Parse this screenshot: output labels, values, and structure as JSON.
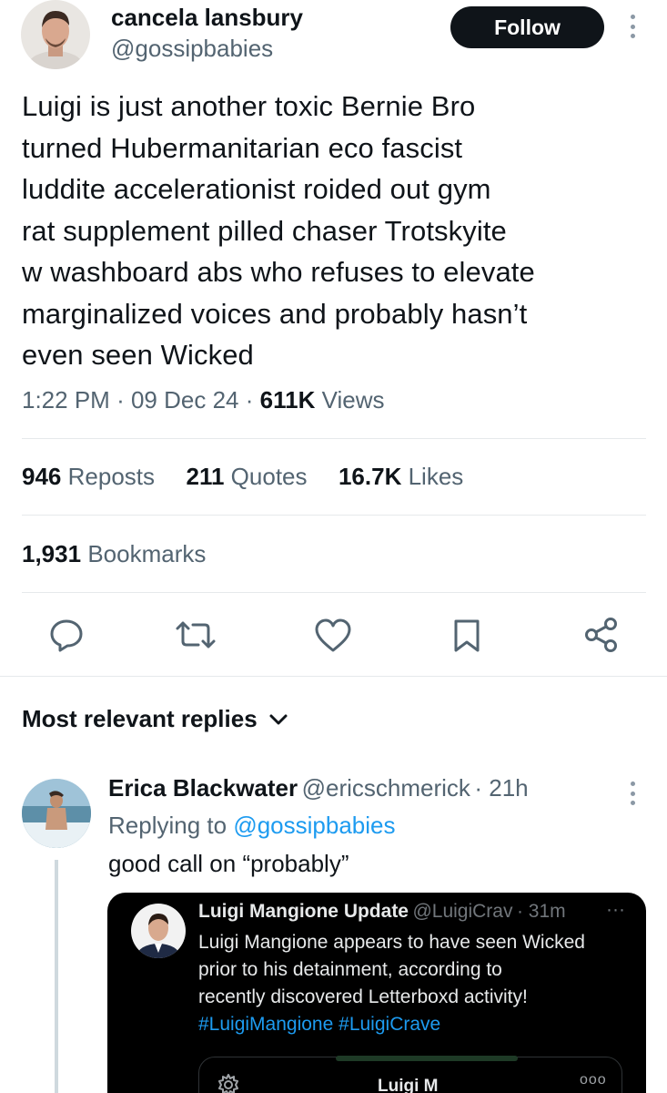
{
  "author": {
    "name": "cancela lansbury",
    "handle": "@gossipbabies",
    "follow_label": "Follow"
  },
  "tweet": {
    "lines": [
      "Luigi is just another toxic Bernie Bro",
      "turned Hubermanitarian eco fascist",
      "luddite accelerationist roided out gym",
      "rat supplement pilled chaser Trotskyite",
      "w washboard abs who refuses to elevate",
      "marginalized voices and probably hasn’t",
      "even seen Wicked"
    ],
    "time": "1:22 PM",
    "date": "09 Dec 24",
    "views_count": "611K",
    "views_label": "Views",
    "sep": "·"
  },
  "stats": {
    "reposts_count": "946",
    "reposts_label": "Reposts",
    "quotes_count": "211",
    "quotes_label": "Quotes",
    "likes_count": "16.7K",
    "likes_label": "Likes",
    "bookmarks_count": "1,931",
    "bookmarks_label": "Bookmarks"
  },
  "actions": [
    "reply-icon",
    "repost-icon",
    "like-icon",
    "bookmark-icon",
    "share-icon"
  ],
  "replies_header": {
    "label": "Most relevant replies",
    "icon": "chevron-down-icon"
  },
  "reply": {
    "name": "Erica Blackwater",
    "handle": "@ericschmerick",
    "age": "· 21h",
    "replying_prefix": "Replying to",
    "replying_handle": "@gossipbabies",
    "text": "good call on “probably”"
  },
  "embedded": {
    "name": "Luigi Mangione Update",
    "handle": "@LuigiCrav",
    "age": "· 31m",
    "more": "···",
    "lines": [
      "Luigi Mangione appears to have seen Wicked",
      "prior to his detainment, according to",
      "recently discovered Letterboxd activity!"
    ],
    "tag1": "#LuigiMangione",
    "tag2": "#LuigiCrave",
    "inner_title": "Luigi M",
    "inner_more": "ooo"
  },
  "colors": {
    "accent": "#1d9bf0",
    "text": "#0f1419",
    "muted": "#536471",
    "follow_bg": "#0f1419"
  }
}
